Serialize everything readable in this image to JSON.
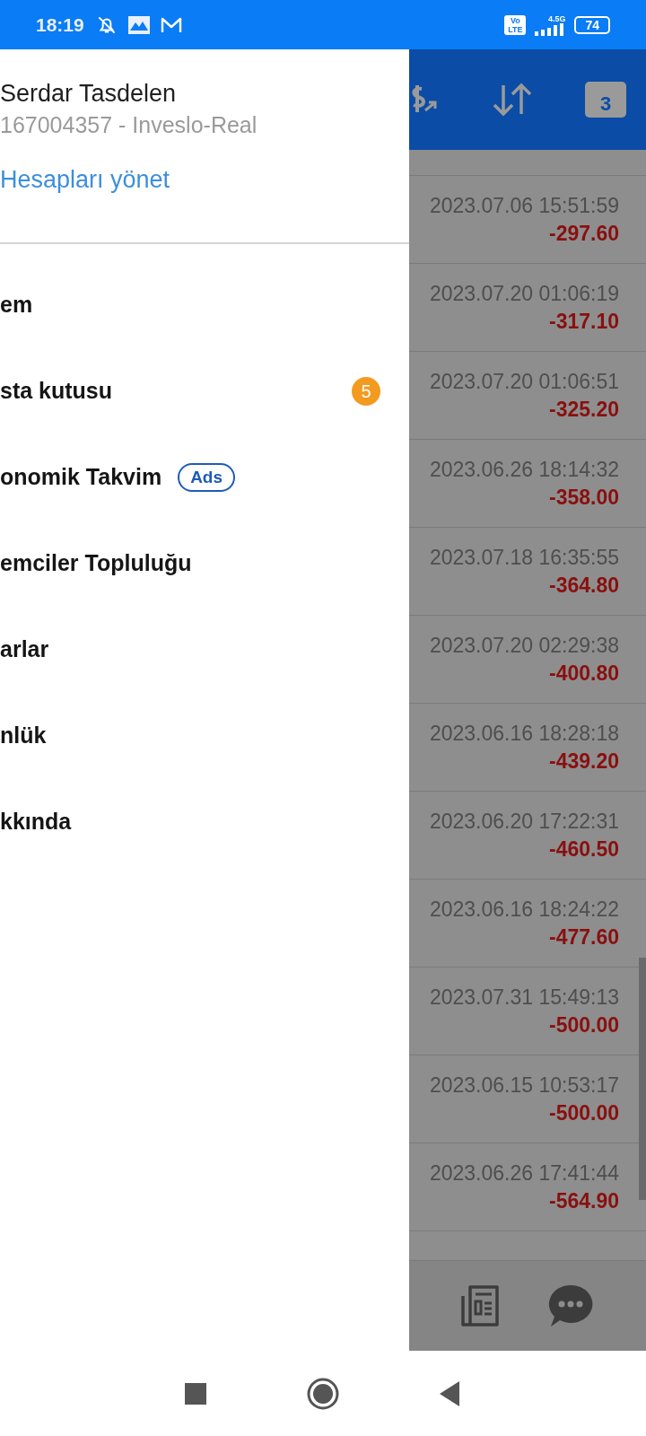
{
  "status_bar": {
    "time": "18:19",
    "network": "4.5G",
    "volte": "Vo LTE",
    "battery": "74"
  },
  "drawer": {
    "account_name": "Serdar Tasdelen",
    "account_id": "167004357 - Inveslo-Real",
    "manage_link": "Hesapları yönet",
    "items": [
      {
        "label": "em"
      },
      {
        "label": "sta kutusu",
        "badge": "5"
      },
      {
        "label": "onomik Takvim",
        "tag": "Ads"
      },
      {
        "label": "emciler Topluluğu"
      },
      {
        "label": "arlar"
      },
      {
        "label": "nlük"
      },
      {
        "label": "kkında"
      }
    ]
  },
  "header": {
    "calendar_day": "3"
  },
  "trades": [
    {
      "time": "2023.07.06 15:51:59",
      "profit": "-297.60"
    },
    {
      "time": "2023.07.20 01:06:19",
      "profit": "-317.10"
    },
    {
      "time": "2023.07.20 01:06:51",
      "profit": "-325.20"
    },
    {
      "time": "2023.06.26 18:14:32",
      "profit": "-358.00"
    },
    {
      "time": "2023.07.18 16:35:55",
      "profit": "-364.80"
    },
    {
      "time": "2023.07.20 02:29:38",
      "profit": "-400.80"
    },
    {
      "time": "2023.06.16 18:28:18",
      "profit": "-439.20"
    },
    {
      "time": "2023.06.20 17:22:31",
      "profit": "-460.50"
    },
    {
      "time": "2023.06.16 18:24:22",
      "profit": "-477.60"
    },
    {
      "time": "2023.07.31 15:49:13",
      "profit": "-500.00"
    },
    {
      "time": "2023.06.15 10:53:17",
      "profit": "-500.00"
    },
    {
      "time": "2023.06.26 17:41:44",
      "profit": "-564.90"
    }
  ]
}
